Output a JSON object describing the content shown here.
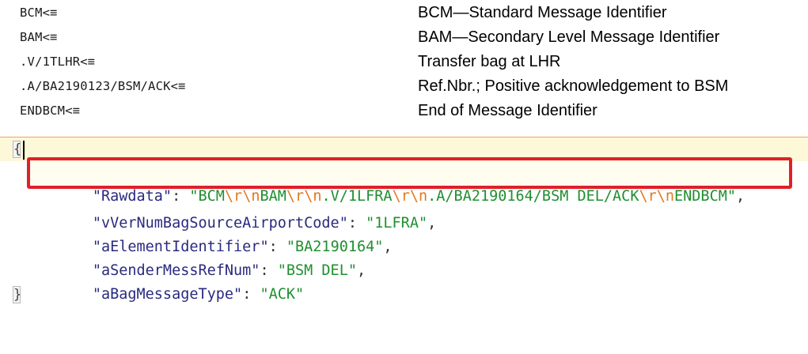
{
  "reference": {
    "rows": [
      {
        "code": "BCM<≡",
        "desc": "BCM—Standard Message Identifier"
      },
      {
        "code": "BAM<≡",
        "desc": "BAM—Secondary Level Message Identifier"
      },
      {
        "code": ".V/1TLHR<≡",
        "desc": "Transfer bag at LHR"
      },
      {
        "code": ".A/BA2190123/BSM/ACK<≡",
        "desc": "Ref.Nbr.; Positive acknowledgement to BSM"
      },
      {
        "code": "ENDBCM<≡",
        "desc": "End of Message Identifier"
      }
    ]
  },
  "json_view": {
    "open_brace": "{",
    "close_brace": "}",
    "rawdata": {
      "key": "\"Rawdata\"",
      "parts": [
        "\"BCM",
        "\\r",
        "\\n",
        "BAM",
        "\\r",
        "\\n",
        ".V/1LFRA",
        "\\r",
        "\\n",
        ".A/BA2190164/BSM DEL/ACK",
        "\\r",
        "\\n",
        "ENDBCM\""
      ],
      "trail": ","
    },
    "fields": [
      {
        "key": "\"vVerNumBagSourceAirportCode\"",
        "value": "\"1LFRA\"",
        "trail": ","
      },
      {
        "key": "\"aElementIdentifier\"",
        "value": "\"BA2190164\"",
        "trail": ","
      },
      {
        "key": "\"aSenderMessRefNum\"",
        "value": "\"BSM DEL\"",
        "trail": ","
      },
      {
        "key": "\"aBagMessageType\"",
        "value": "\"ACK\"",
        "trail": ""
      }
    ],
    "colors": {
      "key": "#2a2a80",
      "string": "#1f8f2f",
      "escape": "#e07a1f",
      "highlight_border": "#e0202a",
      "current_line": "#fcf8d8",
      "divider": "#f0a060"
    }
  }
}
